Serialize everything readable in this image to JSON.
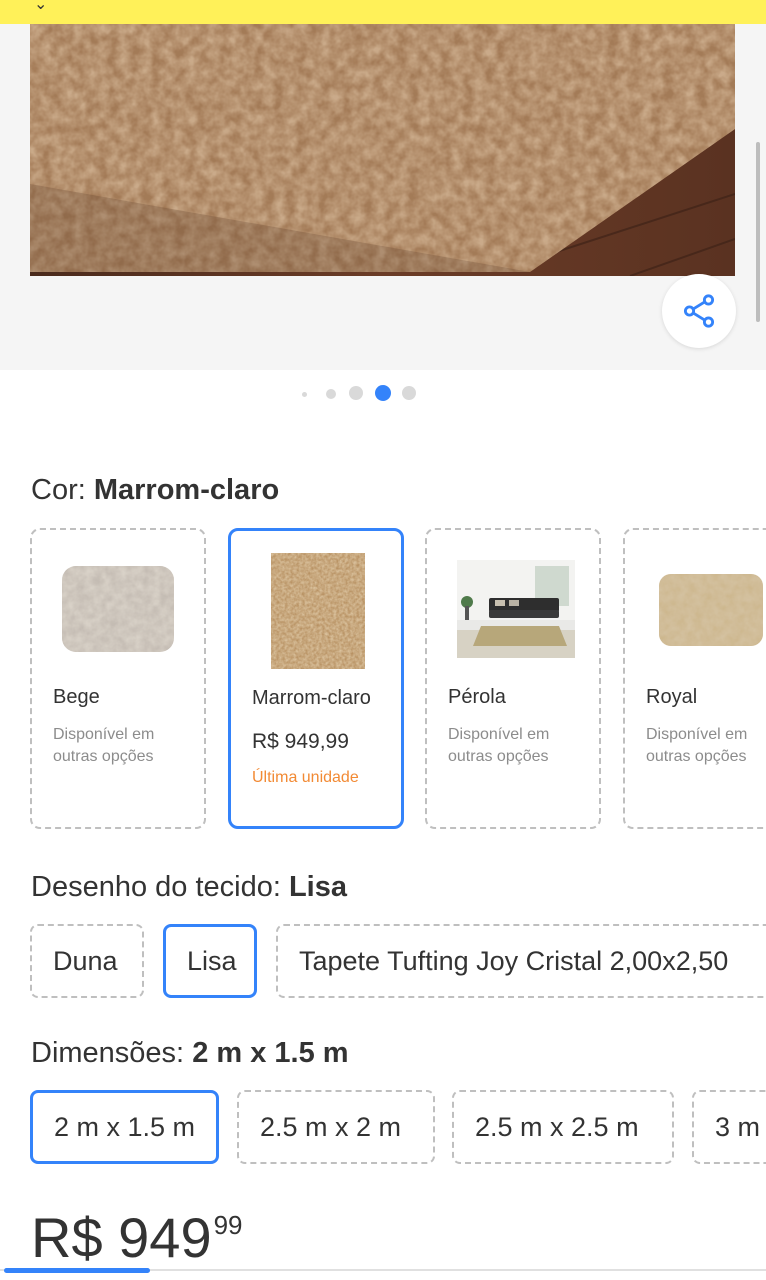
{
  "gallery": {
    "share_icon": "share-icon",
    "dots": {
      "count": 5,
      "active_index": 3
    }
  },
  "color_section": {
    "label": "Cor:",
    "selected": "Marrom-claro",
    "options": [
      {
        "name": "Bege",
        "availability": "Disponível em outras opções"
      },
      {
        "name": "Marrom-claro",
        "price": "R$ 949,99",
        "stock": "Última unidade"
      },
      {
        "name": "Pérola",
        "availability": "Disponível em outras opções"
      },
      {
        "name": "Royal",
        "availability": "Disponível em outras opções"
      }
    ]
  },
  "fabric_section": {
    "label": "Desenho do tecido:",
    "selected": "Lisa",
    "options": [
      "Duna",
      "Lisa",
      "Tapete Tufting Joy Cristal 2,00x2,50"
    ]
  },
  "dimensions_section": {
    "label": "Dimensões:",
    "selected": "2 m x 1.5 m",
    "options": [
      "2 m x 1.5 m",
      "2.5 m x 2 m",
      "2.5 m x 2.5 m",
      "3 m"
    ]
  },
  "price": {
    "currency": "R$",
    "integer": "949",
    "cents": "99"
  },
  "colors": {
    "accent": "#3483fa",
    "topbar": "#fff159",
    "stock": "#f28a34"
  }
}
